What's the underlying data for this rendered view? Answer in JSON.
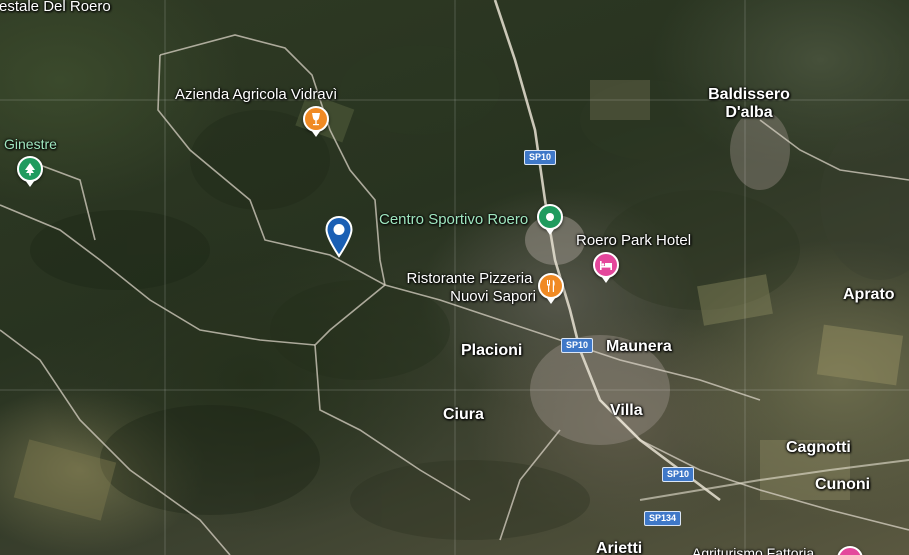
{
  "map": {
    "type": "satellite",
    "colors": {
      "road": "#d8d2c4",
      "shield": "#3f78c8",
      "food": "#f08a24",
      "park": "#1f9b5e",
      "hotel": "#e4479c",
      "selected_marker": "#1a5fb4"
    }
  },
  "labels": {
    "forest": "restale Del Roero",
    "ginestre": "Ginestre",
    "azienda": "Azienda Agricola Vidravì",
    "centro": "Centro Sportivo Roero",
    "hotel": "Roero Park Hotel",
    "ristorante_1": "Ristorante Pizzeria",
    "ristorante_2": "Nuovi Sapori",
    "baldissero_1": "Baldissero",
    "baldissero_2": "D'alba",
    "aprato": "Aprato",
    "placioni": "Placioni",
    "maunera": "Maunera",
    "ciura": "Ciura",
    "villa": "Villa",
    "cagnotti": "Cagnotti",
    "cunoni": "Cunoni",
    "arietti": "Arietti",
    "agriturismo": "Agriturismo Fattoria"
  },
  "roads": {
    "sp10_a": "SP10",
    "sp10_b": "SP10",
    "sp10_c": "SP10",
    "sp134": "SP134"
  },
  "pins": {
    "ginestre": "park-icon",
    "azienda": "wine-icon",
    "centro": "sports-icon",
    "hotel": "hotel-icon",
    "ristorante": "restaurant-icon",
    "agriturismo": "farm-icon",
    "selected": "location-pin-icon"
  }
}
